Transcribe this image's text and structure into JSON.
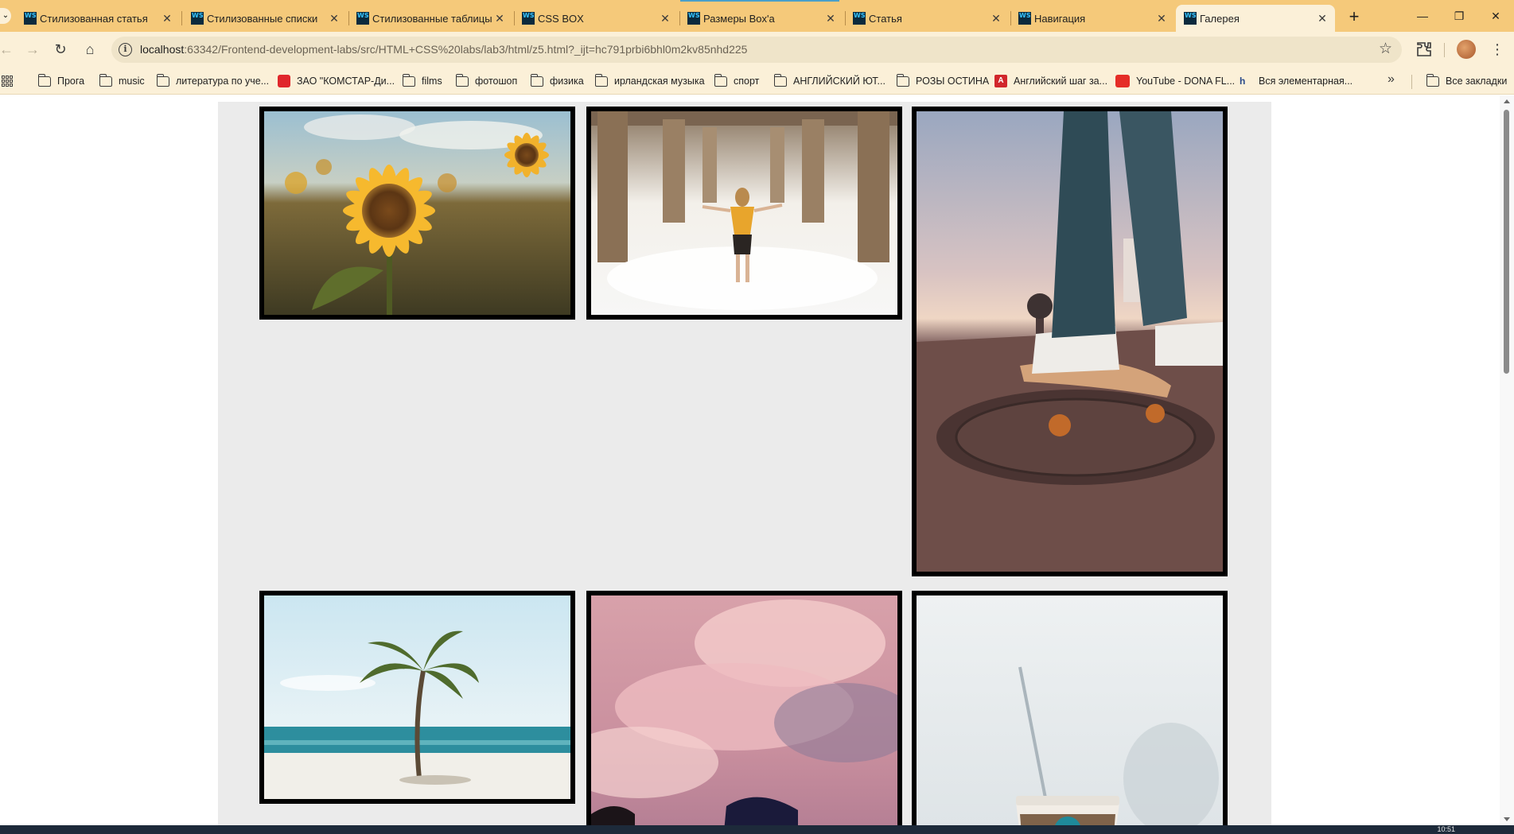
{
  "browser": {
    "tabs": [
      {
        "label": "Стилизованная статья",
        "favicon": "WS"
      },
      {
        "label": "Стилизованные списки",
        "favicon": "WS"
      },
      {
        "label": "Стилизованные таблицы",
        "favicon": "WS"
      },
      {
        "label": "CSS BOX",
        "favicon": "WS"
      },
      {
        "label": "Размеры Box'a",
        "favicon": "WS"
      },
      {
        "label": "Статья",
        "favicon": "WS"
      },
      {
        "label": "Навигация",
        "favicon": "WS"
      },
      {
        "label": "Галерея",
        "favicon": "WS",
        "active": true
      }
    ],
    "close_glyph": "✕",
    "new_tab_glyph": "+",
    "window_controls": {
      "minimize": "—",
      "restore": "❐",
      "close": "✕"
    },
    "url": {
      "host": "localhost",
      "rest": ":63342/Frontend-development-labs/src/HTML+CSS%20labs/lab3/html/z5.html?_ijt=hc791prbi6bhl0m2kv85nhd225"
    },
    "nav_glyphs": {
      "back": "←",
      "forward": "→",
      "reload": "↻",
      "home": "⌂",
      "star": "☆",
      "menu": "⋮",
      "info": "i"
    }
  },
  "bookmarks": [
    {
      "label": "Прога",
      "icon": "folder-icon"
    },
    {
      "label": "music",
      "icon": "folder-icon"
    },
    {
      "label": "литература по уче...",
      "icon": "folder-icon"
    },
    {
      "label": "ЗАО \"КОМСТАР-Ди...",
      "icon": "red-badge-icon"
    },
    {
      "label": "films",
      "icon": "folder-icon"
    },
    {
      "label": "фотошоп",
      "icon": "folder-icon"
    },
    {
      "label": "физика",
      "icon": "folder-icon"
    },
    {
      "label": "ирландская музыка",
      "icon": "folder-icon"
    },
    {
      "label": "спорт",
      "icon": "folder-icon"
    },
    {
      "label": "АНГЛИЙСКИЙ ЮТ...",
      "icon": "folder-icon"
    },
    {
      "label": "РОЗЫ ОСТИНА",
      "icon": "folder-icon"
    },
    {
      "label": "Английский шаг за...",
      "icon": "ab-logo-icon"
    },
    {
      "label": "YouTube - DONA FL...",
      "icon": "youtube-icon"
    },
    {
      "label": "Вся элементарная...",
      "icon": "hc-logo-icon"
    }
  ],
  "bookmarks_more": "»",
  "all_bookmarks": {
    "label": "Все закладки",
    "icon": "folder-icon"
  },
  "taskbar": {
    "clock": "10:51"
  },
  "gallery": {
    "images": [
      {
        "subject": "sunflower"
      },
      {
        "subject": "girl-under-pier"
      },
      {
        "subject": "skateboard"
      },
      {
        "subject": "palm-beach"
      },
      {
        "subject": "pink-clouds"
      },
      {
        "subject": "coffee-cup"
      }
    ]
  },
  "colors": {
    "tab_strip": "#f5c97a",
    "toolbar": "#fbf0d8",
    "gallery_bg": "#ebebeb",
    "frame": "#000000"
  }
}
